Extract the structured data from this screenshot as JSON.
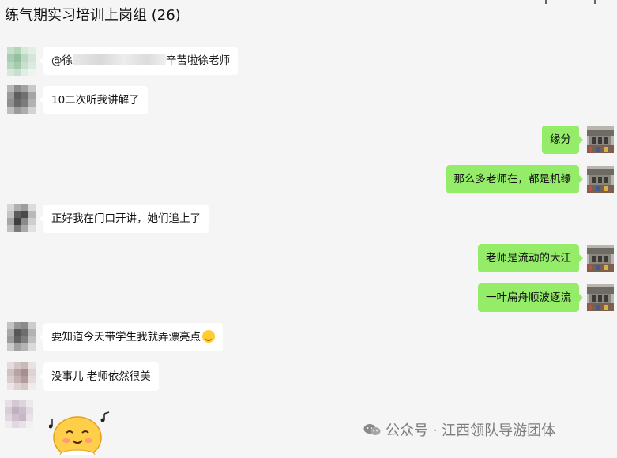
{
  "header": {
    "title": "练气期实习培训上岗组 (26)"
  },
  "messages": [
    {
      "side": "left",
      "text_prefix": "@徐",
      "text_suffix": "辛苦啦徐老师"
    },
    {
      "side": "left",
      "text": "10二次听我讲解了"
    },
    {
      "side": "right",
      "text": "缘分"
    },
    {
      "side": "right",
      "text": "那么多老师在，都是机缘"
    },
    {
      "side": "left",
      "text": "正好我在门口开讲，她们追上了"
    },
    {
      "side": "right",
      "text": "老师是流动的大江"
    },
    {
      "side": "right",
      "text": "一叶扁舟顺波逐流"
    },
    {
      "side": "left",
      "text": "要知道今天带学生我就弄漂亮点",
      "emoji": "grin-sweat-emoji"
    },
    {
      "side": "left",
      "text": "没事儿 老师依然很美"
    },
    {
      "side": "left",
      "sticker": "smiling-blob-sticker"
    }
  ],
  "watermark": {
    "text": "公众号 · 江西领队导游团体",
    "icon": "wechat-icon"
  },
  "colors": {
    "bubble_right": "#95ec69",
    "bubble_left": "#ffffff",
    "background": "#f5f5f5"
  }
}
